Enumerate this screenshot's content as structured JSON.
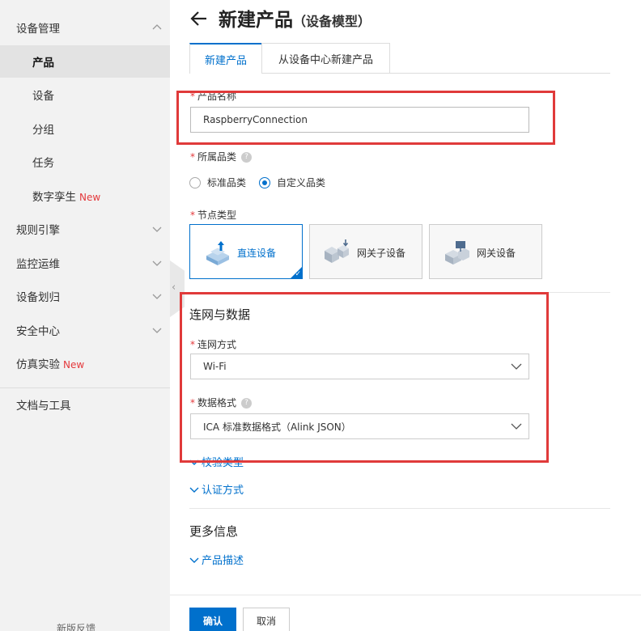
{
  "sidebar": {
    "items": [
      {
        "label": "设备管理",
        "expanded": true
      },
      {
        "label": "产品",
        "active": true
      },
      {
        "label": "设备"
      },
      {
        "label": "分组"
      },
      {
        "label": "任务"
      },
      {
        "label": "数字孪生",
        "badge": "New"
      },
      {
        "label": "规则引擎"
      },
      {
        "label": "监控运维"
      },
      {
        "label": "设备划归"
      },
      {
        "label": "安全中心"
      },
      {
        "label": "仿真实验",
        "badge": "New"
      },
      {
        "label": "文档与工具"
      }
    ],
    "footer": "新版反馈"
  },
  "header": {
    "title": "新建产品",
    "subtitle": "（设备模型）"
  },
  "tabs": [
    {
      "label": "新建产品",
      "active": true
    },
    {
      "label": "从设备中心新建产品"
    }
  ],
  "form": {
    "product_name": {
      "label": "产品名称",
      "value": "RaspberryConnection"
    },
    "category": {
      "label": "所属品类",
      "options": [
        {
          "label": "标准品类",
          "checked": false
        },
        {
          "label": "自定义品类",
          "checked": true
        }
      ]
    },
    "node_type": {
      "label": "节点类型",
      "options": [
        {
          "label": "直连设备",
          "selected": true
        },
        {
          "label": "网关子设备",
          "selected": false
        },
        {
          "label": "网关设备",
          "selected": false
        }
      ]
    },
    "network_section": {
      "title": "连网与数据",
      "connection": {
        "label": "连网方式",
        "value": "Wi-Fi"
      },
      "data_format": {
        "label": "数据格式",
        "value": "ICA 标准数据格式（Alink JSON）"
      }
    },
    "verify_type": "校验类型",
    "auth_method": "认证方式",
    "more_info": {
      "title": "更多信息",
      "product_desc": "产品描述"
    }
  },
  "buttons": {
    "confirm": "确认",
    "cancel": "取消"
  },
  "colors": {
    "primary": "#0070cc",
    "required": "#e4393c",
    "annotation": "#e03a3a"
  }
}
